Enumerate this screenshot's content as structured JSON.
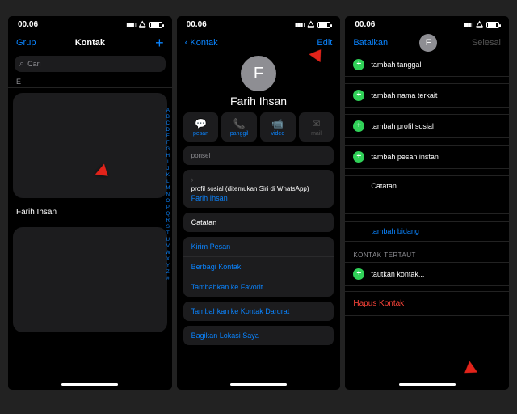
{
  "status": {
    "time": "00.06"
  },
  "screen1": {
    "nav": {
      "left": "Grup",
      "title": "Kontak",
      "right": "+"
    },
    "search_placeholder": "Cari",
    "section": "E",
    "contact_name": "Farih Ihsan",
    "index": [
      "A",
      "B",
      "C",
      "D",
      "E",
      "F",
      "G",
      "H",
      "I",
      "J",
      "K",
      "L",
      "M",
      "N",
      "O",
      "P",
      "Q",
      "R",
      "S",
      "T",
      "U",
      "V",
      "W",
      "X",
      "Y",
      "Z",
      "#"
    ]
  },
  "screen2": {
    "nav": {
      "back": "Kontak",
      "right": "Edit"
    },
    "avatar_initial": "F",
    "contact_name": "Farih Ihsan",
    "actions": [
      {
        "icon": "💬",
        "label": "pesan",
        "enabled": true
      },
      {
        "icon": "📞",
        "label": "panggil",
        "enabled": true
      },
      {
        "icon": "📹",
        "label": "video",
        "enabled": true
      },
      {
        "icon": "✉",
        "label": "mail",
        "enabled": false
      }
    ],
    "ponsel_label": "ponsel",
    "profile": {
      "title": "profil sosial (ditemukan Siri di WhatsApp)",
      "sub": "Farih Ihsan"
    },
    "catatan_label": "Catatan",
    "links": [
      "Kirim Pesan",
      "Berbagi Kontak",
      "Tambahkan ke Favorit",
      "Tambahkan ke Kontak Darurat",
      "Bagikan Lokasi Saya"
    ]
  },
  "screen3": {
    "nav": {
      "left": "Batalkan",
      "right": "Selesai"
    },
    "avatar_initial": "F",
    "adds": [
      "tambah tanggal",
      "tambah nama terkait",
      "tambah profil sosial",
      "tambah pesan instan"
    ],
    "catatan_label": "Catatan",
    "tambah_bidang": "tambah bidang",
    "linked_label": "KONTAK TERTAUT",
    "linked_item": "tautkan kontak...",
    "delete": "Hapus Kontak"
  }
}
